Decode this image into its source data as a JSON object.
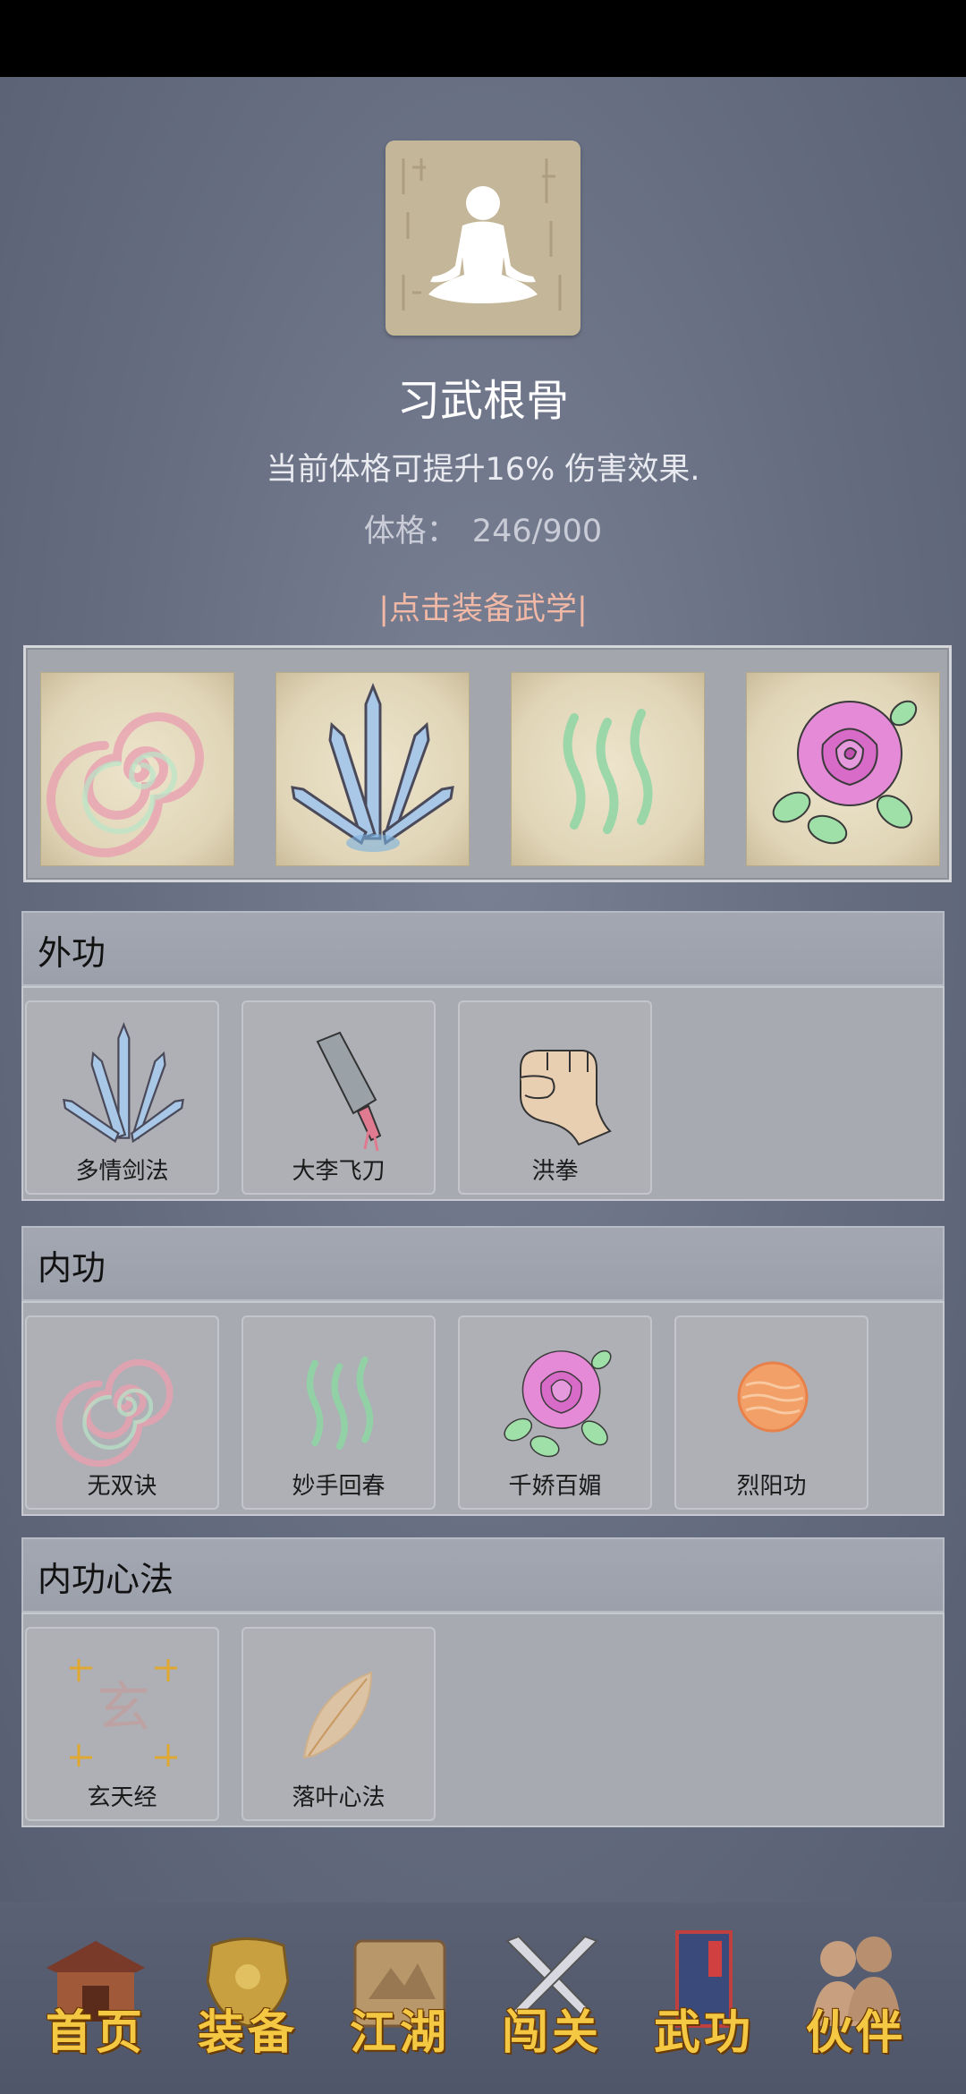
{
  "header": {
    "title": "习武根骨",
    "description": "当前体格可提升16% 伤害效果.",
    "stat_label": "体格：",
    "stat_value": "246/900",
    "equip_link": "|点击装备武学|"
  },
  "sections": [
    {
      "title": "外功",
      "items": [
        {
          "name": "多情剑法",
          "icon": "blades-icon"
        },
        {
          "name": "大李飞刀",
          "icon": "cleaver-icon"
        },
        {
          "name": "洪拳",
          "icon": "fist-icon"
        }
      ]
    },
    {
      "title": "内功",
      "items": [
        {
          "name": "无双诀",
          "icon": "spiral-icon"
        },
        {
          "name": "妙手回春",
          "icon": "wave-icon"
        },
        {
          "name": "千娇百媚",
          "icon": "rose-icon"
        },
        {
          "name": "烈阳功",
          "icon": "sun-orb-icon"
        }
      ]
    },
    {
      "title": "内功心法",
      "items": [
        {
          "name": "玄天经",
          "icon": "xuan-seal-icon",
          "seal_char": "玄"
        },
        {
          "name": "落叶心法",
          "icon": "leaf-icon"
        }
      ]
    }
  ],
  "equipped": [
    "spiral-icon",
    "blades-icon",
    "wave-icon",
    "rose-icon"
  ],
  "nav": [
    {
      "label": "首页",
      "icon": "house-icon"
    },
    {
      "label": "装备",
      "icon": "armor-icon"
    },
    {
      "label": "江湖",
      "icon": "scroll-map-icon"
    },
    {
      "label": "闯关",
      "icon": "crossed-swords-icon"
    },
    {
      "label": "武功",
      "icon": "book-icon"
    },
    {
      "label": "伙伴",
      "icon": "companions-icon"
    }
  ]
}
